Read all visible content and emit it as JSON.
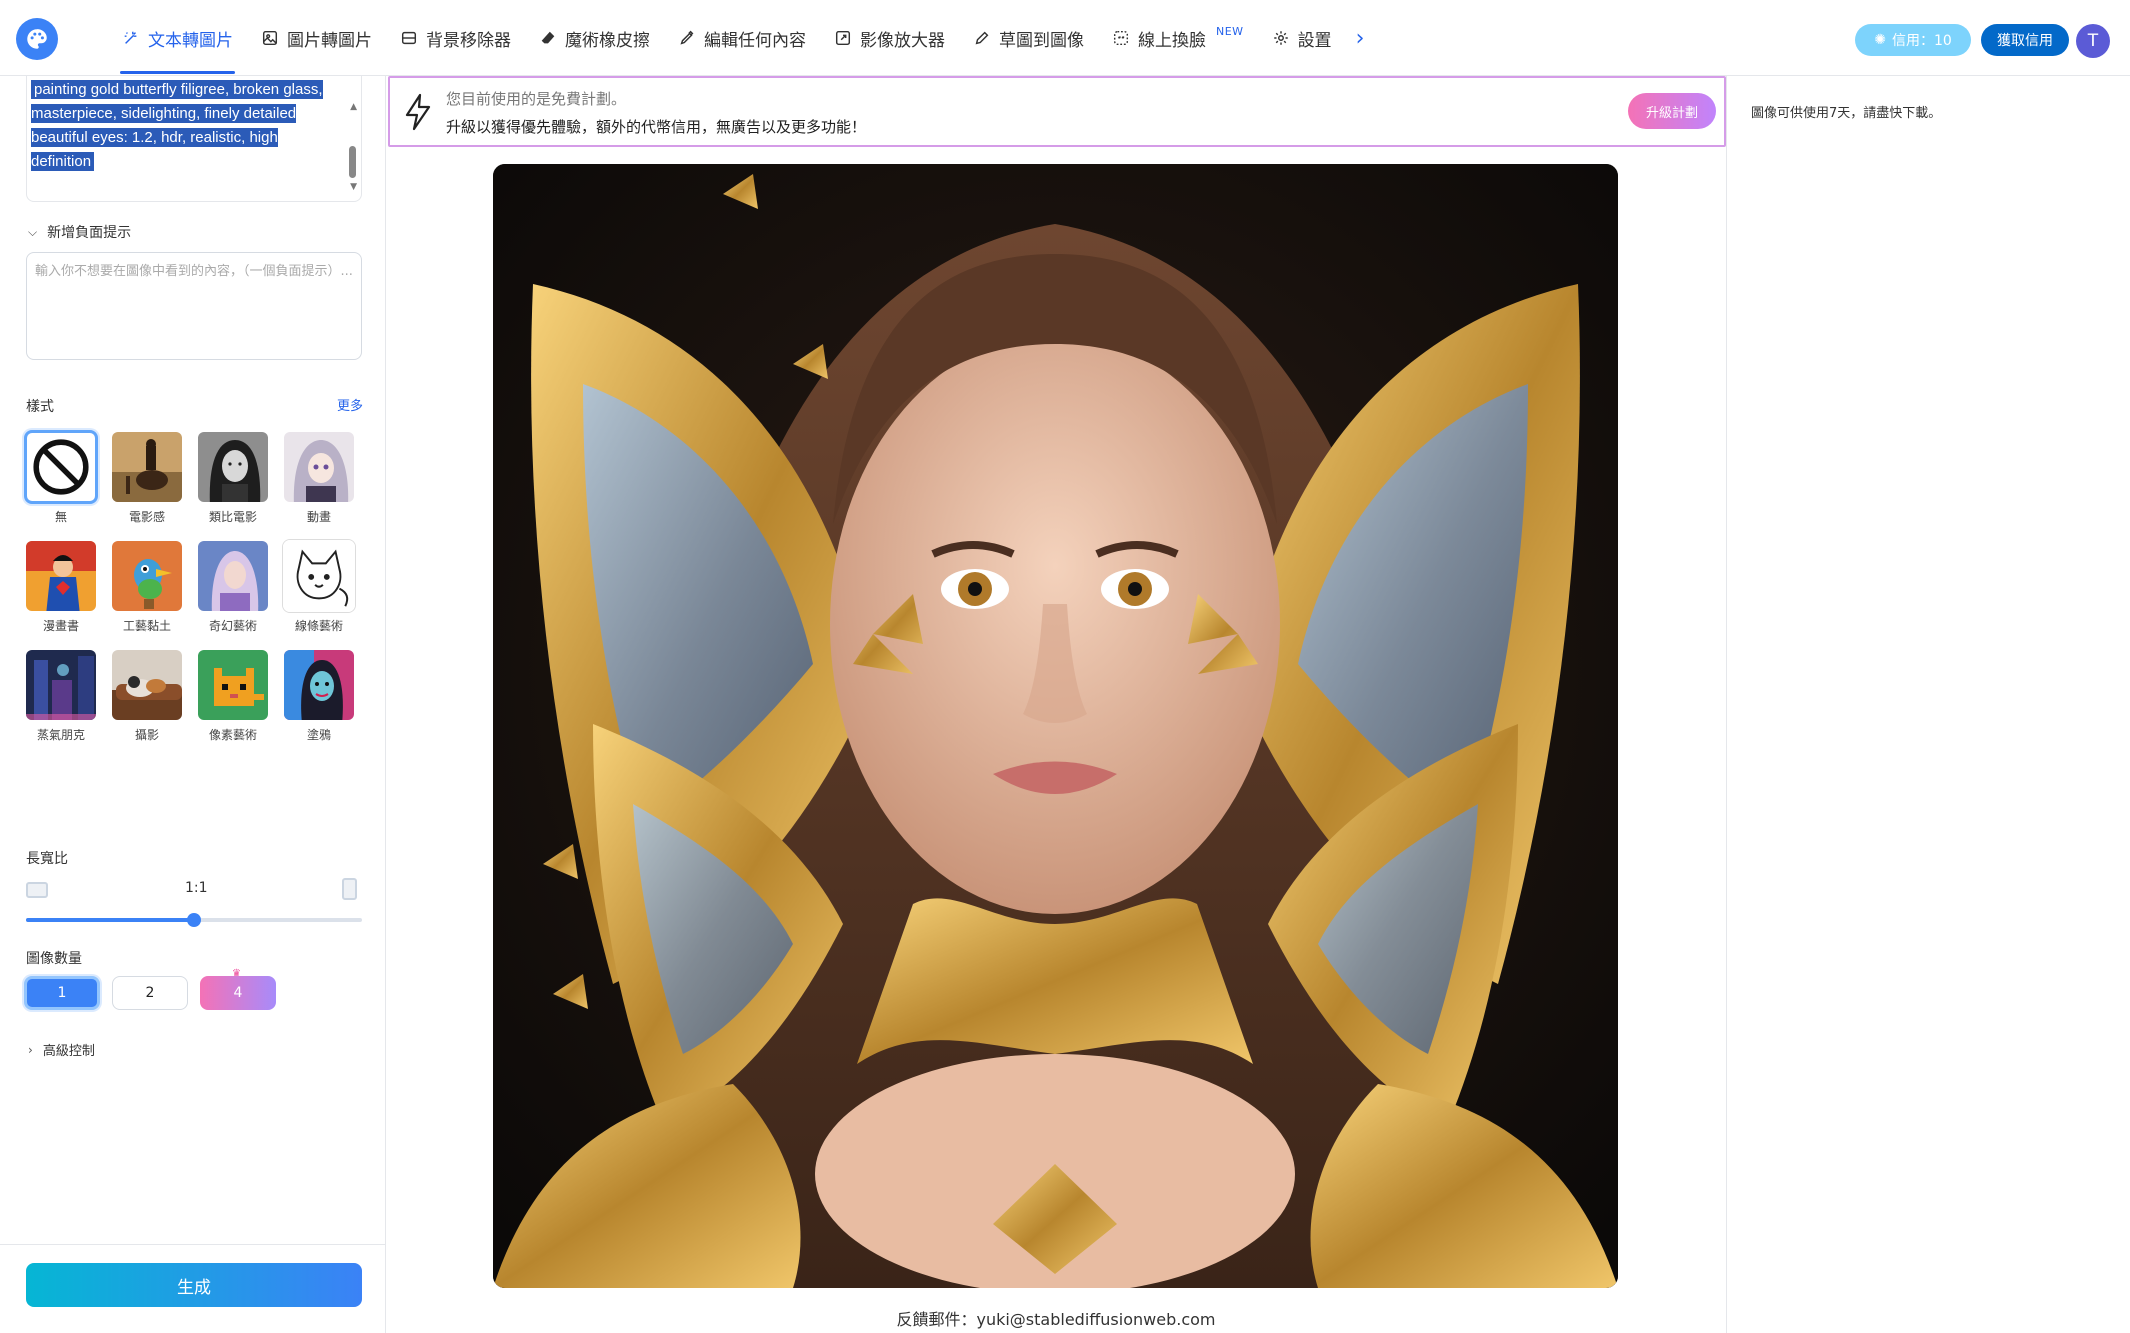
{
  "nav": {
    "tabs": [
      {
        "label": "文本轉圖片",
        "icon": "magic-wand-icon",
        "active": true
      },
      {
        "label": "圖片轉圖片",
        "icon": "image-icon"
      },
      {
        "label": "背景移除器",
        "icon": "background-remover-icon"
      },
      {
        "label": "魔術橡皮擦",
        "icon": "eraser-icon"
      },
      {
        "label": "編輯任何內容",
        "icon": "edit-pen-icon"
      },
      {
        "label": "影像放大器",
        "icon": "upscale-icon"
      },
      {
        "label": "草圖到圖像",
        "icon": "pencil-icon"
      },
      {
        "label": "線上換臉",
        "icon": "face-swap-icon",
        "badge": "NEW"
      },
      {
        "label": "設置",
        "icon": "gear-icon"
      }
    ],
    "credits_label": "信用：10",
    "buy_label": "獲取信用",
    "avatar_initial": "T"
  },
  "left": {
    "prompt_text": "painting gold butterfly filigree, broken glass, masterpiece, sidelighting, finely detailed beautiful eyes: 1.2, hdr, realistic, high definition",
    "negative_toggle_label": "新增負面提示",
    "negative_placeholder": "輸入你不想要在圖像中看到的內容，（一個負面提示）...",
    "style_label": "樣式",
    "style_more": "更多",
    "styles": [
      {
        "name": "無",
        "selected": true
      },
      {
        "name": "電影感"
      },
      {
        "name": "類比電影"
      },
      {
        "name": "動畫"
      },
      {
        "name": "漫畫書"
      },
      {
        "name": "工藝黏土"
      },
      {
        "name": "奇幻藝術"
      },
      {
        "name": "線條藝術"
      },
      {
        "name": "蒸氣朋克"
      },
      {
        "name": "攝影"
      },
      {
        "name": "像素藝術"
      },
      {
        "name": "塗鴉"
      }
    ],
    "aspect_label": "長寬比",
    "aspect_value": "1:1",
    "aspect_slider_fraction": 0.5,
    "count_label": "圖像數量",
    "counts": [
      "1",
      "2",
      "4"
    ],
    "selected_count": "1",
    "advanced_label": "高級控制",
    "generate_label": "生成"
  },
  "center": {
    "banner_line1": "您目前使用的是免費計劃。",
    "banner_line2": "升級以獲得優先體驗，額外的代幣信用，無廣告以及更多功能！",
    "upgrade_label": "升級計劃",
    "feedback": "反饋郵件：yuki@stablediffusionweb.com"
  },
  "right": {
    "note": "圖像可供使用7天，請盡快下載。"
  },
  "colors": {
    "accent": "#2563eb",
    "generate_gradient_start": "#06b6d4",
    "generate_gradient_end": "#3b82f6",
    "upgrade_gradient": "#f472b6"
  }
}
